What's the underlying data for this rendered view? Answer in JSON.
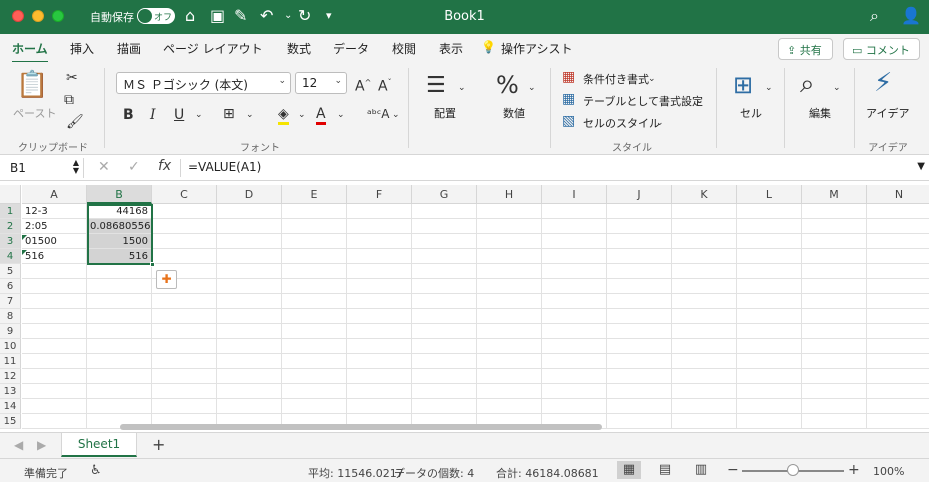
{
  "window": {
    "title": "Book1"
  },
  "titlebar": {
    "autosave_label": "自動保存",
    "autosave_state": "オフ"
  },
  "tabs": [
    "ホーム",
    "挿入",
    "描画",
    "ページ レイアウト",
    "数式",
    "データ",
    "校閲",
    "表示",
    "操作アシスト"
  ],
  "share_label": "共有",
  "comment_label": "コメント",
  "ribbon": {
    "paste_label": "ペースト",
    "clipboard_group": "クリップボード",
    "font_name": "ＭＳ Ｐゴシック (本文)",
    "font_size": "12",
    "bold": "B",
    "italic": "I",
    "underline": "U",
    "font_group": "フォント",
    "align_label": "配置",
    "number_label": "数値",
    "cond_format": "条件付き書式",
    "table_format": "テーブルとして書式設定",
    "cell_styles": "セルのスタイル",
    "style_group": "スタイル",
    "cells_label": "セル",
    "edit_label": "編集",
    "ideas_label": "アイデア",
    "ideas_group": "アイデア"
  },
  "formula_bar": {
    "name_box": "B1",
    "formula": "=VALUE(A1)"
  },
  "columns": [
    "A",
    "B",
    "C",
    "D",
    "E",
    "F",
    "G",
    "H",
    "I",
    "J",
    "K",
    "L",
    "M",
    "N"
  ],
  "rows": [
    "1",
    "2",
    "3",
    "4",
    "5",
    "6",
    "7",
    "8",
    "9",
    "10",
    "11",
    "12",
    "13",
    "14",
    "15"
  ],
  "cells": {
    "A": [
      "12-3",
      "2:05",
      "01500",
      "516"
    ],
    "B": [
      "44168",
      "0.08680556",
      "1500",
      "516"
    ]
  },
  "sheet_tab": "Sheet1",
  "status": {
    "ready": "準備完了",
    "average": "平均: 11546.0217",
    "count": "データの個数: 4",
    "sum": "合計: 46184.08681",
    "zoom": "100%"
  },
  "colors": {
    "accent": "#217346"
  }
}
